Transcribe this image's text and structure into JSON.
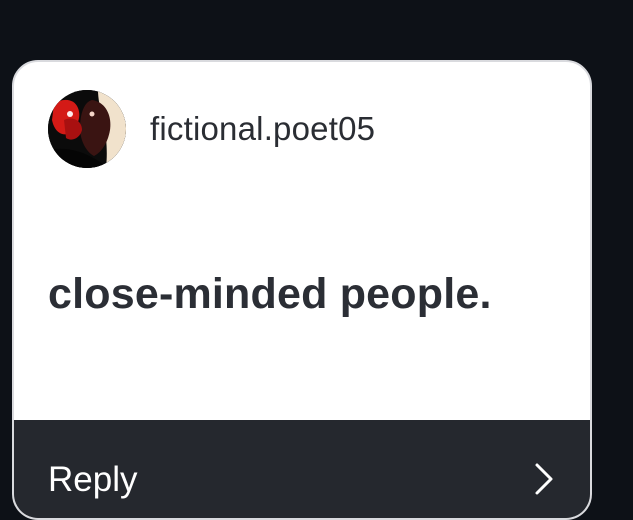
{
  "post": {
    "username": "fictional.poet05",
    "message": "close-minded people.",
    "avatar_icon": "profile-avatar"
  },
  "reply": {
    "label": "Reply",
    "icon": "chevron-right-icon"
  },
  "colors": {
    "background": "#0d1117",
    "card": "#ffffff",
    "reply_bar": "#25282e",
    "text_dark": "#2a2d33"
  }
}
